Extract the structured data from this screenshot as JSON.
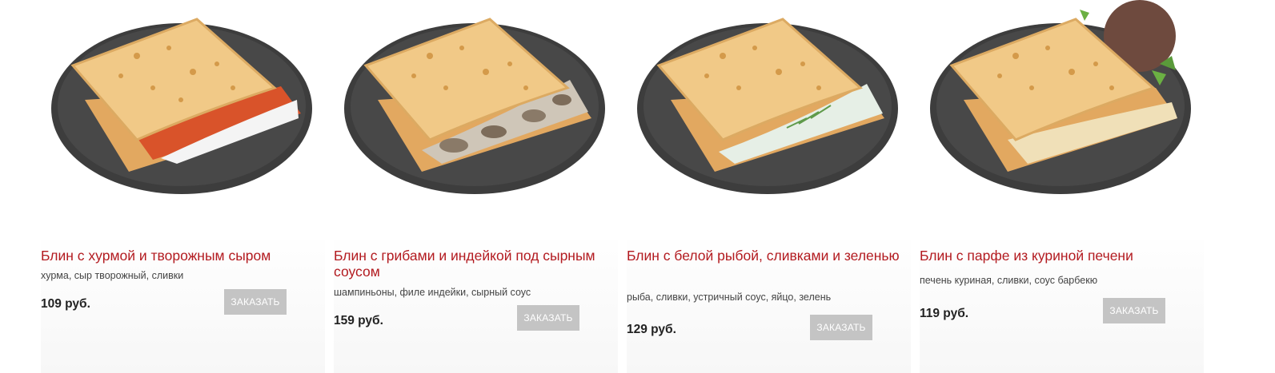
{
  "products": [
    {
      "title": "Блин с хурмой и творожным сыром",
      "description": "хурма, сыр творожный, сливки",
      "price": "109 руб.",
      "button_label": "ЗАКАЗАТЬ",
      "filling_color": "#d9532a"
    },
    {
      "title": "Блин с грибами и индейкой под сырным соусом",
      "description": "шампиньоны, филе индейки, сырный соус",
      "price": "159 руб.",
      "button_label": "ЗАКАЗАТЬ",
      "filling_color": "#cfc6b8"
    },
    {
      "title": "Блин с белой рыбой, сливками и зеленью",
      "description": "рыба, сливки, устричный соус, яйцо, зелень",
      "price": "129 руб.",
      "button_label": "ЗАКАЗАТЬ",
      "filling_color": "#e6efe6"
    },
    {
      "title": "Блин с парфе из куриной печени",
      "description": "печень куриная, сливки, соус барбекю",
      "price": "119 руб.",
      "button_label": "ЗАКАЗАТЬ",
      "filling_color": "#f0e0b8"
    }
  ],
  "colors": {
    "title": "#b31b20",
    "button_bg": "#c4c4c4",
    "plate": "#3c3c3c",
    "pancake": "#f1c987"
  }
}
